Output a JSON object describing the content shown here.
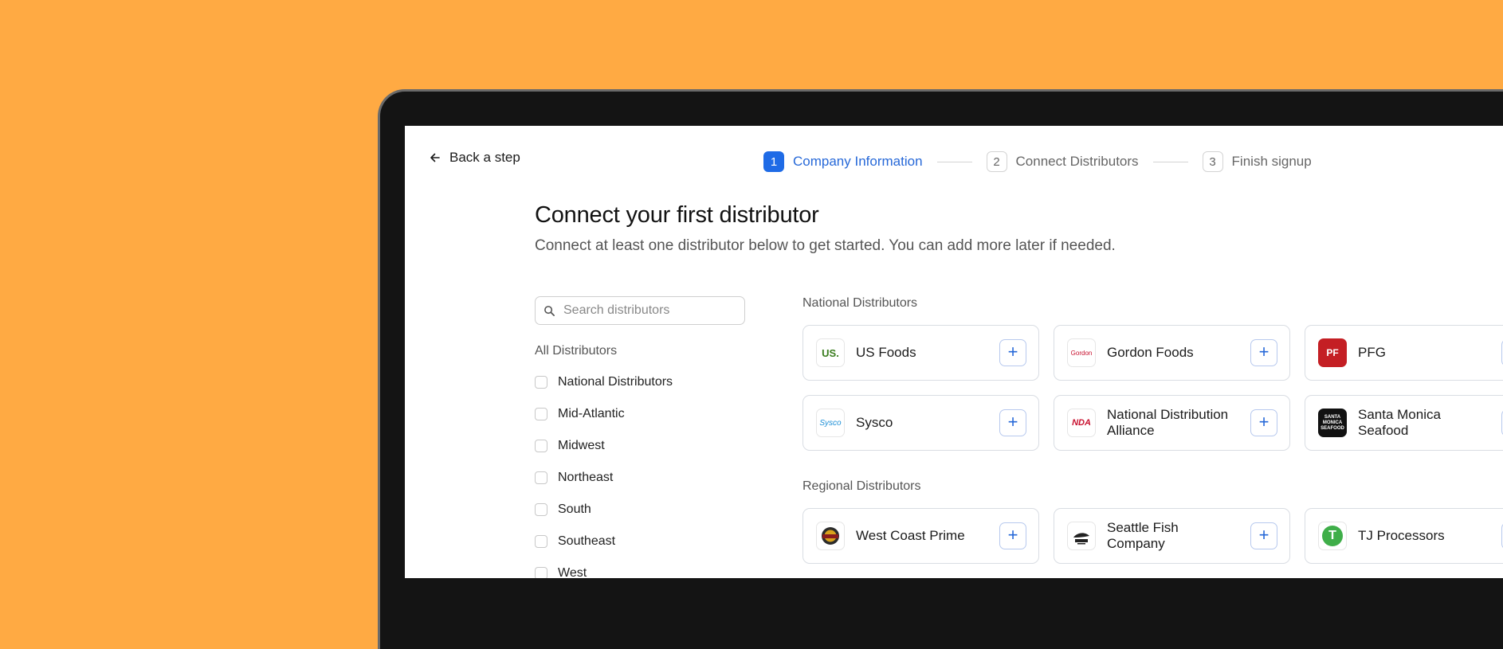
{
  "header": {
    "back_label": "Back a step",
    "steps": [
      {
        "num": "1",
        "label": "Company Information"
      },
      {
        "num": "2",
        "label": "Connect Distributors"
      },
      {
        "num": "3",
        "label": "Finish signup"
      }
    ]
  },
  "main": {
    "title": "Connect your first distributor",
    "subtitle": "Connect at least one distributor below to get started. You can add more later if needed."
  },
  "sidebar": {
    "search_placeholder": "Search distributors",
    "heading": "All Distributors",
    "filters": [
      "National Distributors",
      "Mid-Atlantic",
      "Midwest",
      "Northeast",
      "South",
      "Southeast",
      "West"
    ]
  },
  "sections": {
    "national": {
      "label": "National Distributors",
      "cards": [
        {
          "name": "US Foods",
          "logo_text": "US."
        },
        {
          "name": "Gordon Foods",
          "logo_text": "Gordon"
        },
        {
          "name": "PFG",
          "logo_text": "PF"
        },
        {
          "name": "Sysco",
          "logo_text": "Sysco"
        },
        {
          "name": "National Distribution Alliance",
          "logo_text": "NDA"
        },
        {
          "name": "Santa Monica Seafood",
          "logo_text": "SANTA MONICA SEAFOOD"
        }
      ]
    },
    "regional": {
      "label": "Regional Distributors",
      "cards": [
        {
          "name": "West Coast Prime",
          "logo_text": ""
        },
        {
          "name": "Seattle Fish Company",
          "logo_text": ""
        },
        {
          "name": "TJ Processors",
          "logo_text": "T"
        }
      ]
    }
  },
  "colors": {
    "background": "#FFAA43",
    "accent": "#1F6BE6",
    "device_frame": "#141414"
  }
}
